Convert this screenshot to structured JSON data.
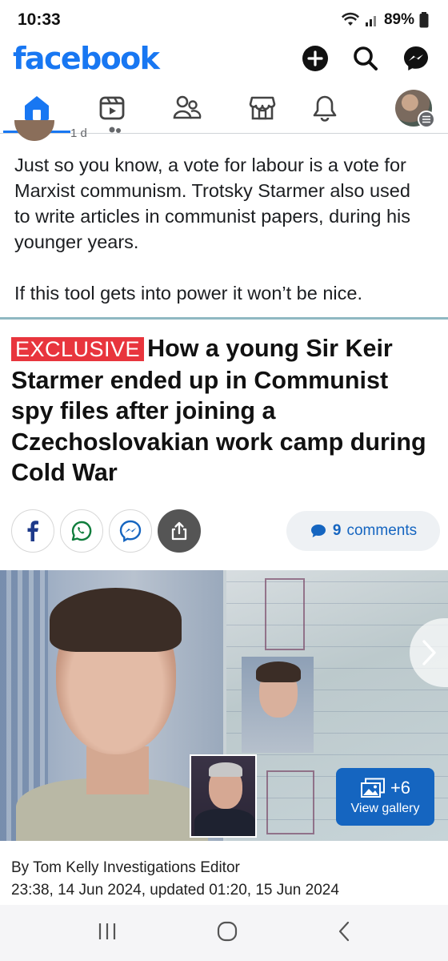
{
  "status_bar": {
    "time": "10:33",
    "battery": "89%"
  },
  "header": {
    "logo": "facebook",
    "icons": [
      "plus-icon",
      "search-icon",
      "messenger-icon"
    ]
  },
  "tabs": [
    {
      "name": "home-icon",
      "active": true
    },
    {
      "name": "video-icon",
      "active": false
    },
    {
      "name": "friends-icon",
      "active": false
    },
    {
      "name": "marketplace-icon",
      "active": false
    },
    {
      "name": "bell-icon",
      "active": false
    },
    {
      "name": "profile-avatar",
      "active": false
    }
  ],
  "post": {
    "meta_partial": "1 d",
    "paragraph_1": "Just so you know, a vote for labour is a vote for Marxist communism. Trotsky Starmer also used to write articles in communist papers, during his younger years.",
    "paragraph_2": "If this tool gets into power it won’t be nice."
  },
  "article": {
    "badge": "EXCLUSIVE",
    "headline": "How a young Sir Keir Starmer ended up in Communist spy files after joining a Czechoslovakian work camp during Cold War",
    "comments_count": "9",
    "comments_label": "comments",
    "gallery_count": "+6",
    "gallery_label": "View gallery",
    "byline": "By Tom Kelly Investigations Editor",
    "dateline": "23:38, 14 Jun 2024, updated 01:20, 15 Jun 2024"
  },
  "colors": {
    "brand": "#1877f2",
    "exclusive": "#e8353d",
    "link_blue": "#1565c0"
  }
}
